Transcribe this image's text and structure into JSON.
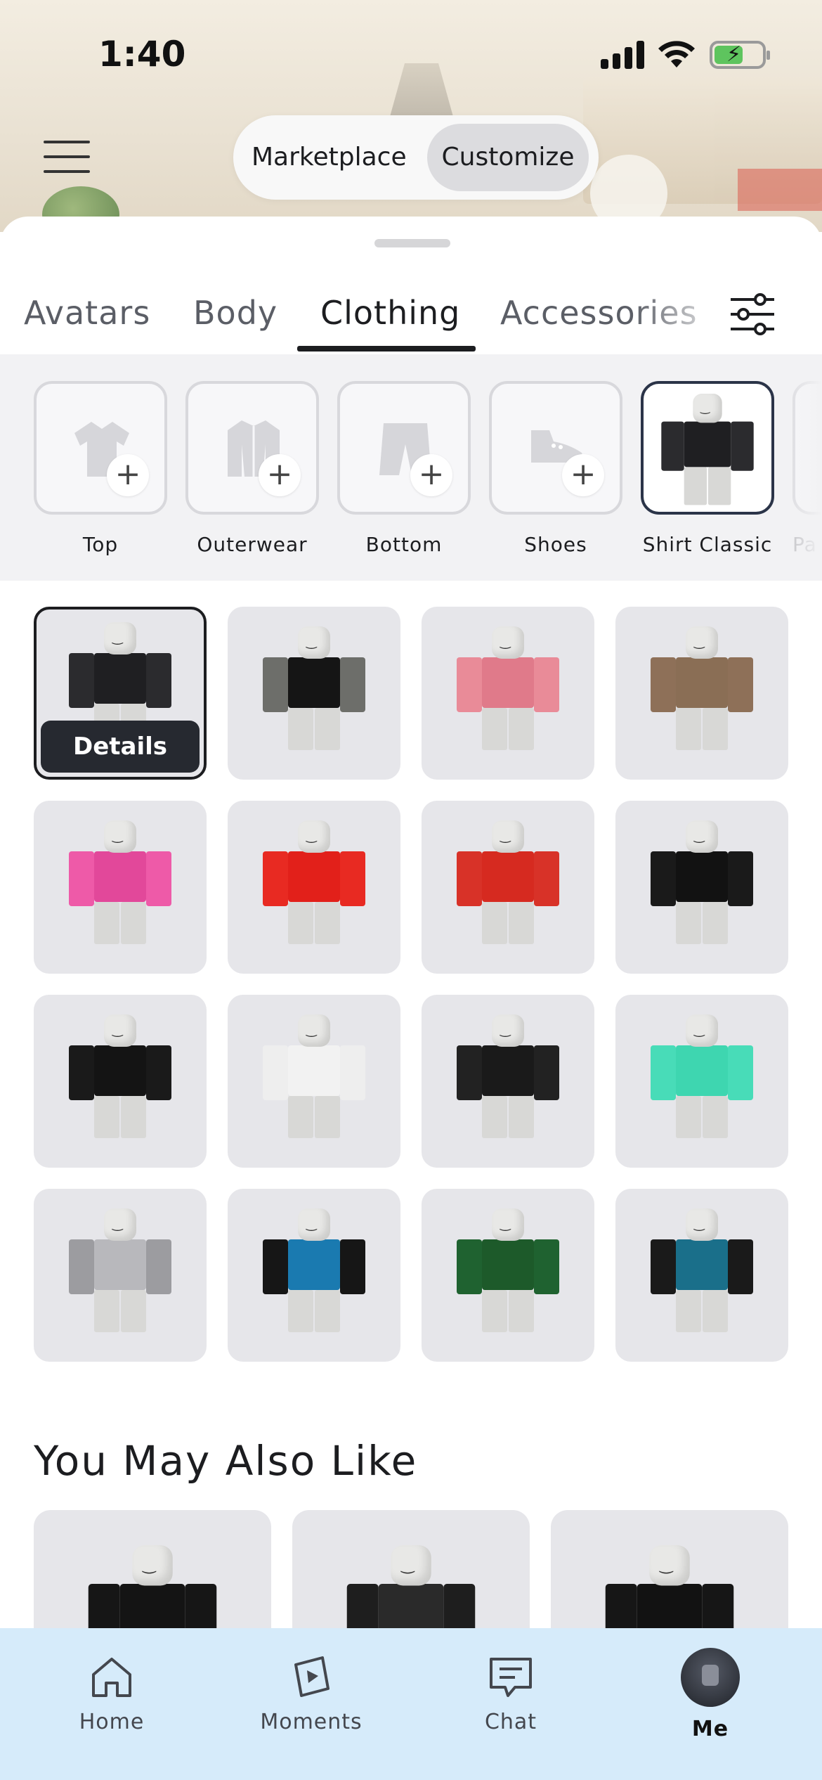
{
  "status_bar": {
    "time": "1:40"
  },
  "top_switch": {
    "marketplace": "Marketplace",
    "customize": "Customize",
    "selected": "Customize"
  },
  "category_tabs": [
    {
      "label": "Avatars",
      "active": false
    },
    {
      "label": "Body",
      "active": false
    },
    {
      "label": "Clothing",
      "active": true
    },
    {
      "label": "Accessories",
      "active": false
    }
  ],
  "slots": [
    {
      "label": "Top",
      "icon": "shirt-icon",
      "empty": true
    },
    {
      "label": "Outerwear",
      "icon": "jacket-icon",
      "empty": true
    },
    {
      "label": "Bottom",
      "icon": "pants-icon",
      "empty": true
    },
    {
      "label": "Shoes",
      "icon": "shoe-icon",
      "empty": true
    },
    {
      "label": "Shirt Classic",
      "icon": "shirt-thumbnail",
      "empty": false,
      "selected": true
    },
    {
      "label": "Pa",
      "icon": "pants-thumbnail",
      "empty": true
    }
  ],
  "items": [
    {
      "torso": "#1f1f22",
      "arms": "#2b2b2e",
      "selected": true,
      "details_label": "Details"
    },
    {
      "torso": "#151515",
      "arms": "#6d6e6a"
    },
    {
      "torso": "#e07a8a",
      "arms": "#e98b98"
    },
    {
      "torso": "#8a6e55",
      "arms": "#8e7058"
    },
    {
      "torso": "#e2489a",
      "arms": "#ee5aa8"
    },
    {
      "torso": "#e2201a",
      "arms": "#e82a22"
    },
    {
      "torso": "#d62a20",
      "arms": "#d83228"
    },
    {
      "torso": "#121212",
      "arms": "#1a1a1a"
    },
    {
      "torso": "#141414",
      "arms": "#1a1a1a"
    },
    {
      "torso": "#f2f2f2",
      "arms": "#eeeeee"
    },
    {
      "torso": "#1a1a1a",
      "arms": "#222222"
    },
    {
      "torso": "#3ed6b0",
      "arms": "#48dcb8"
    },
    {
      "torso": "#b8b8bc",
      "arms": "#9c9ca0"
    },
    {
      "torso": "#1a7ab0",
      "arms": "#161616"
    },
    {
      "torso": "#1d5a2a",
      "arms": "#1f6230"
    },
    {
      "torso": "#1a6f8a",
      "arms": "#1a1a1a"
    }
  ],
  "section_title": "You May Also Like",
  "recommendations": [
    {
      "torso": "#141414",
      "arms": "#161616"
    },
    {
      "torso": "#2a2a2a",
      "arms": "#1e1e1e"
    },
    {
      "torso": "#121212",
      "arms": "#161616"
    }
  ],
  "bottom_nav": [
    {
      "label": "Home",
      "icon": "home-icon",
      "active": false
    },
    {
      "label": "Moments",
      "icon": "moments-icon",
      "active": false
    },
    {
      "label": "Chat",
      "icon": "chat-icon",
      "active": false
    },
    {
      "label": "Me",
      "icon": "avatar",
      "active": true
    }
  ]
}
